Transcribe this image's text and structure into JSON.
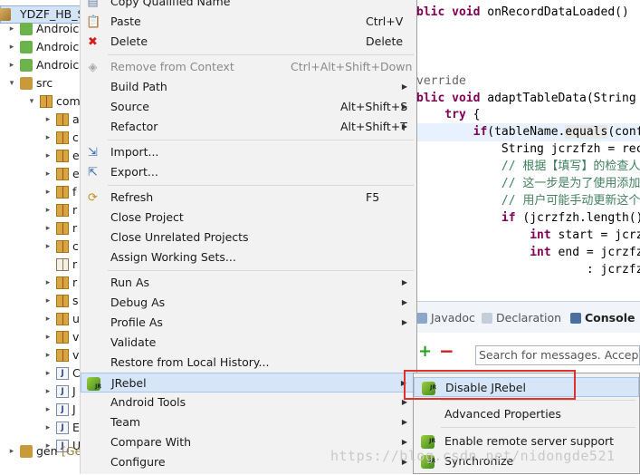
{
  "tree": {
    "rows": [
      {
        "label": "YDZF_HB_S",
        "toggle": "▾",
        "icon": "project"
      },
      {
        "label": "Androic",
        "toggle": "▸",
        "icon": "android"
      },
      {
        "label": "Androic",
        "toggle": "▸",
        "icon": "android"
      },
      {
        "label": "Androic",
        "toggle": "▸",
        "icon": "android"
      },
      {
        "label": "src",
        "toggle": "▾",
        "icon": "src"
      },
      {
        "label": "com",
        "toggle": "▾",
        "icon": "package"
      },
      {
        "label": "a",
        "toggle": "▸",
        "icon": "package"
      },
      {
        "label": "c",
        "toggle": "▸",
        "icon": "package"
      },
      {
        "label": "e",
        "toggle": "▸",
        "icon": "package"
      },
      {
        "label": "e",
        "toggle": "▸",
        "icon": "package"
      },
      {
        "label": "f",
        "toggle": "▸",
        "icon": "package"
      },
      {
        "label": "r",
        "toggle": "▸",
        "icon": "package"
      },
      {
        "label": "r",
        "toggle": "▸",
        "icon": "package"
      },
      {
        "label": "c",
        "toggle": "▸",
        "icon": "package"
      },
      {
        "label": "r",
        "toggle": "",
        "icon": "package-empty"
      },
      {
        "label": "r",
        "toggle": "▸",
        "icon": "package"
      },
      {
        "label": "s",
        "toggle": "▸",
        "icon": "package"
      },
      {
        "label": "u",
        "toggle": "▸",
        "icon": "package"
      },
      {
        "label": "v",
        "toggle": "▸",
        "icon": "package"
      },
      {
        "label": "v",
        "toggle": "▸",
        "icon": "package"
      },
      {
        "label": "C",
        "toggle": "▸",
        "icon": "java"
      },
      {
        "label": "J",
        "toggle": "▸",
        "icon": "java"
      },
      {
        "label": "J",
        "toggle": "▸",
        "icon": "java"
      },
      {
        "label": "E",
        "toggle": "▸",
        "icon": "java"
      },
      {
        "label": "U",
        "toggle": "▸",
        "icon": "java"
      },
      {
        "label": "gen",
        "suffix": "[Ge",
        "toggle": "▸",
        "icon": "gen"
      }
    ]
  },
  "editor": {
    "lines": [
      {
        "parts": [
          {
            "t": "blic ",
            "c": "kw"
          },
          {
            "t": "void ",
            "c": "kw"
          },
          {
            "t": "onRecordDataLoaded()",
            "c": ""
          }
        ]
      },
      {
        "parts": []
      },
      {
        "parts": []
      },
      {
        "parts": []
      },
      {
        "parts": [
          {
            "t": "verride",
            "c": "ann"
          }
        ]
      },
      {
        "parts": [
          {
            "t": "blic ",
            "c": "kw"
          },
          {
            "t": "void ",
            "c": "kw"
          },
          {
            "t": "adaptTableData(String",
            "c": ""
          }
        ]
      },
      {
        "parts": [
          {
            "t": "    try ",
            "c": "kw"
          },
          {
            "t": "{",
            "c": ""
          }
        ]
      },
      {
        "parts": [
          {
            "t": "        if",
            "c": "kw"
          },
          {
            "t": "(tableName.",
            "c": ""
          },
          {
            "t": "equals",
            "c": "hl"
          },
          {
            "t": "(confi",
            "c": ""
          }
        ]
      },
      {
        "parts": [
          {
            "t": "            String jcrzfzh = reco",
            "c": ""
          }
        ]
      },
      {
        "parts": [
          {
            "t": "            // 根据【填写】的检查人",
            "c": "cmt"
          }
        ]
      },
      {
        "parts": [
          {
            "t": "            // 这一步是为了使用添加",
            "c": "cmt"
          }
        ]
      },
      {
        "parts": [
          {
            "t": "            // 用户可能手动更新这个",
            "c": "cmt"
          }
        ]
      },
      {
        "parts": [
          {
            "t": "            if ",
            "c": "kw"
          },
          {
            "t": "(jcrzfzh.length()",
            "c": ""
          }
        ]
      },
      {
        "parts": [
          {
            "t": "                int ",
            "c": "kw"
          },
          {
            "t": "start = jcrz",
            "c": ""
          }
        ]
      },
      {
        "parts": [
          {
            "t": "                int ",
            "c": "kw"
          },
          {
            "t": "end = jcrzfzh",
            "c": ""
          }
        ]
      },
      {
        "parts": [
          {
            "t": "                        : jcrzfzh",
            "c": ""
          }
        ]
      }
    ]
  },
  "views": {
    "tabs": [
      {
        "label": "Javadoc",
        "active": false
      },
      {
        "label": "Declaration",
        "active": false
      },
      {
        "label": "Console",
        "active": true
      }
    ],
    "search_placeholder": "Search for messages. Accepts"
  },
  "context_menu": {
    "items": [
      {
        "label": "Copy Qualified Name",
        "accel": "",
        "submenu": false,
        "disabled": false,
        "icon": "copy-qualified-icon"
      },
      {
        "label": "Paste",
        "accel": "Ctrl+V",
        "submenu": false,
        "disabled": false,
        "icon": "paste-icon"
      },
      {
        "label": "Delete",
        "accel": "Delete",
        "submenu": false,
        "disabled": false,
        "icon": "delete-icon"
      },
      {
        "sep": true
      },
      {
        "label": "Remove from Context",
        "accel": "Ctrl+Alt+Shift+Down",
        "submenu": false,
        "disabled": true,
        "icon": "remove-context-icon"
      },
      {
        "label": "Build Path",
        "accel": "",
        "submenu": true,
        "disabled": false,
        "icon": ""
      },
      {
        "label": "Source",
        "accel": "Alt+Shift+S",
        "submenu": true,
        "disabled": false,
        "icon": ""
      },
      {
        "label": "Refactor",
        "accel": "Alt+Shift+T",
        "submenu": true,
        "disabled": false,
        "icon": ""
      },
      {
        "sep": true
      },
      {
        "label": "Import...",
        "accel": "",
        "submenu": false,
        "disabled": false,
        "icon": "import-icon"
      },
      {
        "label": "Export...",
        "accel": "",
        "submenu": false,
        "disabled": false,
        "icon": "export-icon"
      },
      {
        "sep": true
      },
      {
        "label": "Refresh",
        "accel": "F5",
        "submenu": false,
        "disabled": false,
        "icon": "refresh-icon"
      },
      {
        "label": "Close Project",
        "accel": "",
        "submenu": false,
        "disabled": false,
        "icon": ""
      },
      {
        "label": "Close Unrelated Projects",
        "accel": "",
        "submenu": false,
        "disabled": false,
        "icon": ""
      },
      {
        "label": "Assign Working Sets...",
        "accel": "",
        "submenu": false,
        "disabled": false,
        "icon": ""
      },
      {
        "sep": true
      },
      {
        "label": "Run As",
        "accel": "",
        "submenu": true,
        "disabled": false,
        "icon": ""
      },
      {
        "label": "Debug As",
        "accel": "",
        "submenu": true,
        "disabled": false,
        "icon": ""
      },
      {
        "label": "Profile As",
        "accel": "",
        "submenu": true,
        "disabled": false,
        "icon": ""
      },
      {
        "label": "Validate",
        "accel": "",
        "submenu": false,
        "disabled": false,
        "icon": ""
      },
      {
        "label": "Restore from Local History...",
        "accel": "",
        "submenu": false,
        "disabled": false,
        "icon": ""
      },
      {
        "label": "JRebel",
        "accel": "",
        "submenu": true,
        "disabled": false,
        "icon": "jrebel-icon",
        "hover": true
      },
      {
        "label": "Android Tools",
        "accel": "",
        "submenu": true,
        "disabled": false,
        "icon": ""
      },
      {
        "label": "Team",
        "accel": "",
        "submenu": true,
        "disabled": false,
        "icon": ""
      },
      {
        "label": "Compare With",
        "accel": "",
        "submenu": true,
        "disabled": false,
        "icon": ""
      },
      {
        "label": "Configure",
        "accel": "",
        "submenu": true,
        "disabled": false,
        "icon": ""
      }
    ]
  },
  "jrebel_submenu": {
    "items": [
      {
        "label": "Disable JRebel",
        "icon": "jrebel-icon",
        "hover": true
      },
      {
        "sep": true
      },
      {
        "label": "Advanced Properties",
        "icon": ""
      },
      {
        "sep": true
      },
      {
        "label": "Enable remote server support",
        "icon": "jrebel-icon"
      },
      {
        "label": "Synchronize",
        "icon": "jrebel-icon"
      }
    ]
  },
  "watermark": "https://blog.csdn.net/nidongde521",
  "colors": {
    "highlight_box": "#e0312c",
    "menu_hover": "#d6e6f8",
    "keyword": "#7f0055",
    "comment": "#3f7f5f"
  }
}
